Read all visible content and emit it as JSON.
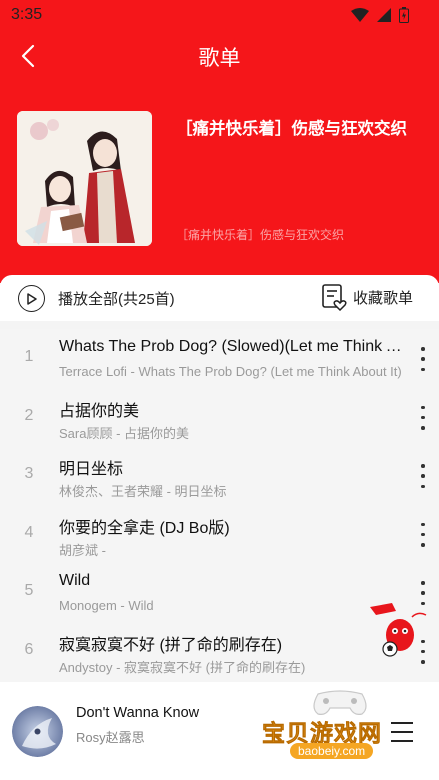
{
  "status": {
    "time": "3:35"
  },
  "nav": {
    "title": "歌单"
  },
  "playlist": {
    "name": "［痛并快乐着］伤感与狂欢交织",
    "description": "［痛并快乐着］伤感与狂欢交织"
  },
  "actions": {
    "play_all": "播放全部(共25首)",
    "collect": "收藏歌单"
  },
  "songs": [
    {
      "index": "1",
      "title": "Whats The Prob Dog? (Slowed)(Let me Think About It)",
      "subtitle": "Terrace Lofi - Whats The Prob Dog? (Let me Think About It)"
    },
    {
      "index": "2",
      "title": "占据你的美",
      "subtitle": "Sara顾顾 - 占据你的美"
    },
    {
      "index": "3",
      "title": "明日坐标",
      "subtitle": "林俊杰、王者荣耀 - 明日坐标"
    },
    {
      "index": "4",
      "title": "你要的全拿走 (DJ Bo版)",
      "subtitle": "胡彦斌 -"
    },
    {
      "index": "5",
      "title": "Wild",
      "subtitle": "Monogem - Wild"
    },
    {
      "index": "6",
      "title": "寂寞寂寞不好 (拼了命的刷存在)",
      "subtitle": "Andystoy - 寂寞寂寞不好 (拼了命的刷存在)"
    }
  ],
  "player": {
    "song": "Don't Wanna Know",
    "artist": "Rosy赵露思"
  },
  "watermark": {
    "text": "宝贝游戏网",
    "url": "baobeiy.com"
  },
  "colors": {
    "accent": "#f5161a"
  }
}
